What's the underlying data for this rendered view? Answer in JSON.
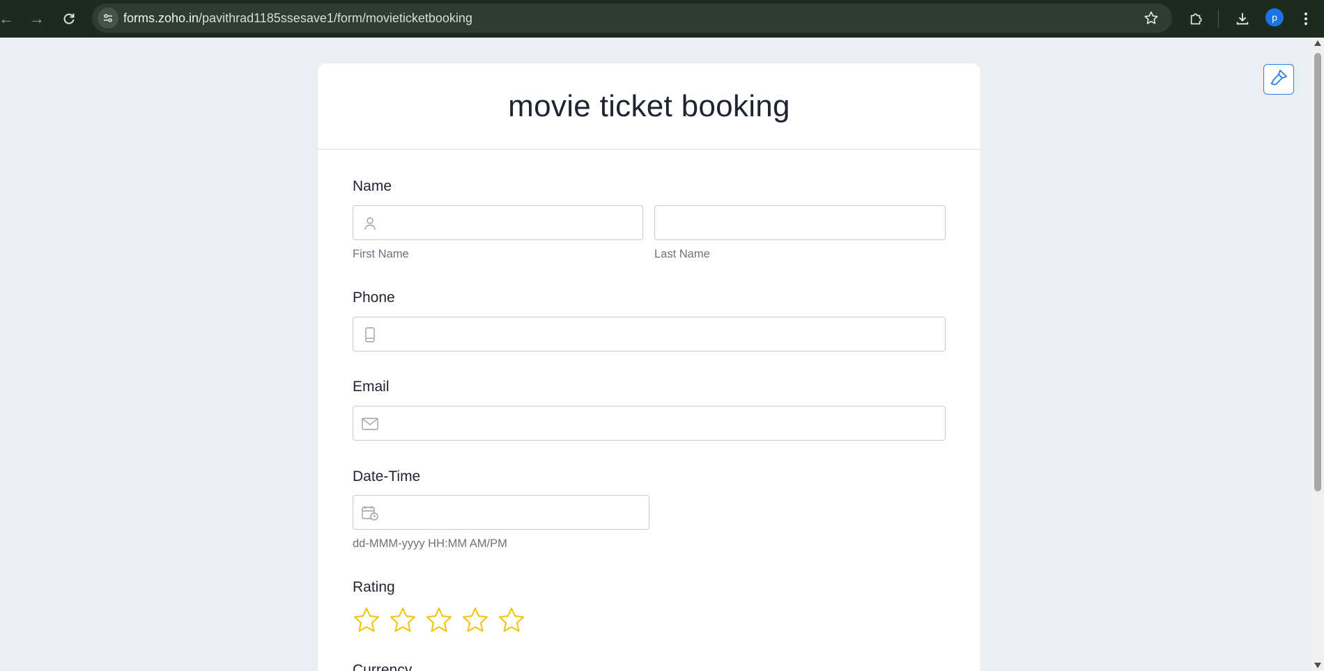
{
  "browser": {
    "url_host": "forms.zoho.in",
    "url_path": "/pavithrad1185ssesave1/form/movieticketbooking",
    "profile_initial": "p"
  },
  "form": {
    "title": "movie ticket booking",
    "name": {
      "label": "Name",
      "first_sublabel": "First Name",
      "last_sublabel": "Last Name",
      "first_value": "",
      "last_value": ""
    },
    "phone": {
      "label": "Phone",
      "value": ""
    },
    "email": {
      "label": "Email",
      "value": ""
    },
    "datetime": {
      "label": "Date-Time",
      "value": "",
      "format_hint": "dd-MMM-yyyy HH:MM AM/PM"
    },
    "rating": {
      "label": "Rating",
      "max": 5,
      "value": 0,
      "star_color": "#f2c200"
    },
    "currency": {
      "label": "Currency"
    }
  },
  "colors": {
    "accent": "#2b7de9",
    "chrome_bg": "#1c2b1e",
    "page_bg": "#eceef3"
  }
}
